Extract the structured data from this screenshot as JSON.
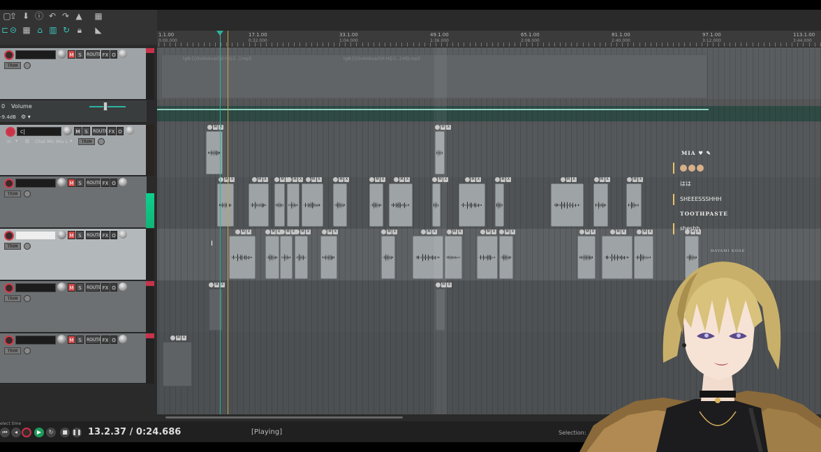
{
  "toolbar": {
    "icons": [
      "new-project-icon",
      "save-icon",
      "import-icon",
      "info-icon",
      "undo-icon",
      "redo-icon",
      "metronome-icon",
      "grid-icon",
      "link-icon",
      "snap-icon",
      "loop-icon",
      "lock-icon",
      "ripple-icon",
      "trim-icon"
    ]
  },
  "tracks": [
    {
      "name": "",
      "record_armed": false,
      "has_route": true
    },
    {
      "name": "c|",
      "record_armed": true,
      "input": "in",
      "input_channel": "Chat Mic Mix L"
    },
    {
      "name": "",
      "record_armed": false
    },
    {
      "name": "",
      "record_armed": false,
      "selected": true
    },
    {
      "name": "",
      "record_armed": false
    },
    {
      "name": "",
      "record_armed": false
    }
  ],
  "envelope": {
    "label": "Volume",
    "value_label": "-9.4dB",
    "prefix": "0"
  },
  "buttons": {
    "mute": "M",
    "solo": "S",
    "route": "ROUTE",
    "fx": "FX",
    "io": "O",
    "trim": "TRIM"
  },
  "ruler": {
    "marks": [
      {
        "bar": "1.1.00",
        "time": "0:00.000"
      },
      {
        "bar": "17.1.00",
        "time": "0:32.000"
      },
      {
        "bar": "33.1.00",
        "time": "1:04.000"
      },
      {
        "bar": "49.1.00",
        "time": "1:36.000"
      },
      {
        "bar": "65.1.00",
        "time": "2:08.000"
      },
      {
        "bar": "81.1.00",
        "time": "2:40.000"
      },
      {
        "bar": "97.1.00",
        "time": "3:12.000"
      },
      {
        "bar": "113.1.00",
        "time": "3:44.000"
      }
    ]
  },
  "items": {
    "top_label_1": "tgN-[{Ov4inkvaz]VI-HQ-[...]-mp3",
    "top_label_2": "tgN-[{Ov4inkvaz]VI-HQ-[...]-HQ-mp3"
  },
  "transport": {
    "time": "13.2.37 / 0:24.686",
    "status": "[Playing]",
    "selection": "Selection:",
    "select_time_hint": "elect time"
  },
  "chat": {
    "messages": [
      {
        "text": "MIA ♥ ✎",
        "style": "bold"
      },
      {
        "text": "",
        "style": "emoji",
        "emoji_count": 3
      },
      {
        "text": "はは",
        "style": "plain"
      },
      {
        "text": "SHEEESSSHHH",
        "style": "bar"
      },
      {
        "text": "TOOTHPASTE",
        "style": "bold"
      },
      {
        "text": "sheshh",
        "style": "bar"
      }
    ],
    "watermark": "HAYAMI KOGE"
  },
  "colors": {
    "accent_teal": "#3cc1b8",
    "record_red": "#c8324a",
    "meter_green": "#0ecf8f",
    "item_gray": "#9ea4a6",
    "cursor_gold": "#c9a24a"
  }
}
